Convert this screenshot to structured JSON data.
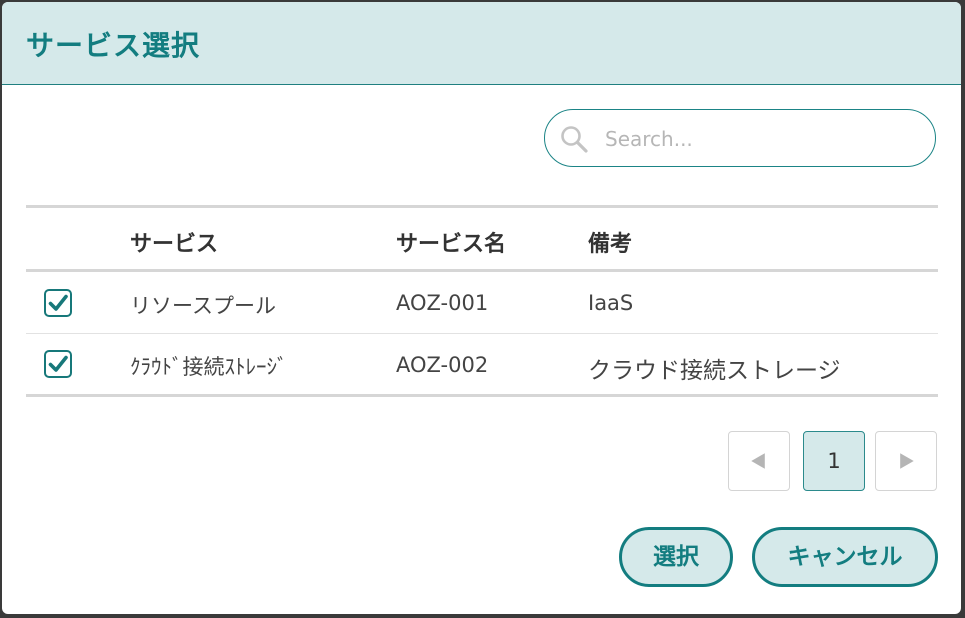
{
  "dialog": {
    "title": "サービス選択"
  },
  "search": {
    "placeholder": "Search..."
  },
  "table": {
    "headers": [
      "サービス",
      "サービス名",
      "備考"
    ],
    "rows": [
      {
        "checked": true,
        "service": "リソースプール",
        "service_name": "AOZ-001",
        "note": "IaaS"
      },
      {
        "checked": true,
        "service": "ｸﾗｳﾄﾞ接続ｽﾄﾚｰｼﾞ",
        "service_name": "AOZ-002",
        "note": "クラウド接続ストレージ"
      }
    ]
  },
  "pagination": {
    "current_page": "1"
  },
  "actions": {
    "select_label": "選択",
    "cancel_label": "キャンセル"
  },
  "colors": {
    "accent": "#137d80",
    "header_bg": "#d5e9ea"
  }
}
